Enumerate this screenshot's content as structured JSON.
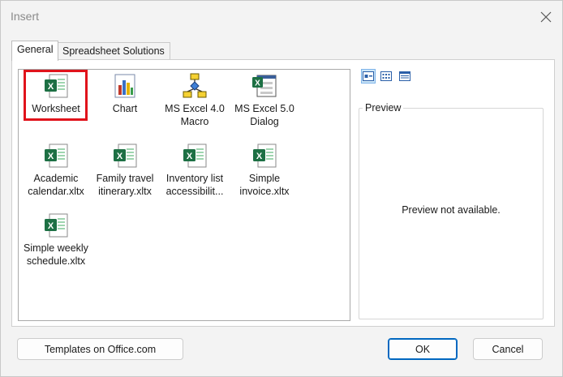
{
  "dialog": {
    "title": "Insert",
    "close_icon": "close-icon"
  },
  "tabs": [
    {
      "label": "General",
      "active": true
    },
    {
      "label": "Spreadsheet Solutions",
      "active": false
    }
  ],
  "items": [
    {
      "line1": "Worksheet",
      "line2": "",
      "icon": "excel-worksheet-icon",
      "selected": true
    },
    {
      "line1": "Chart",
      "line2": "",
      "icon": "chart-icon",
      "selected": false
    },
    {
      "line1": "MS Excel 4.0",
      "line2": "Macro",
      "icon": "macro-icon",
      "selected": false
    },
    {
      "line1": "MS Excel 5.0",
      "line2": "Dialog",
      "icon": "dialog-sheet-icon",
      "selected": false
    },
    {
      "line1": "Academic",
      "line2": "calendar.xltx",
      "icon": "excel-template-icon",
      "selected": false
    },
    {
      "line1": "Family travel",
      "line2": "itinerary.xltx",
      "icon": "excel-template-icon",
      "selected": false
    },
    {
      "line1": "Inventory list",
      "line2": "accessibilit...",
      "icon": "excel-template-icon",
      "selected": false
    },
    {
      "line1": "Simple",
      "line2": "invoice.xltx",
      "icon": "excel-template-icon",
      "selected": false
    },
    {
      "line1": "Simple weekly",
      "line2": "schedule.xltx",
      "icon": "excel-template-icon",
      "selected": false
    }
  ],
  "view_buttons": [
    {
      "name": "large-icons-view",
      "active": true
    },
    {
      "name": "list-view",
      "active": false
    },
    {
      "name": "details-view",
      "active": false
    }
  ],
  "preview": {
    "legend": "Preview",
    "message": "Preview not available."
  },
  "buttons": {
    "templates": "Templates on Office.com",
    "ok": "OK",
    "cancel": "Cancel"
  },
  "colors": {
    "excel_green": "#1d7044",
    "highlight_red": "#e0131b",
    "accent_blue": "#0067c0"
  }
}
